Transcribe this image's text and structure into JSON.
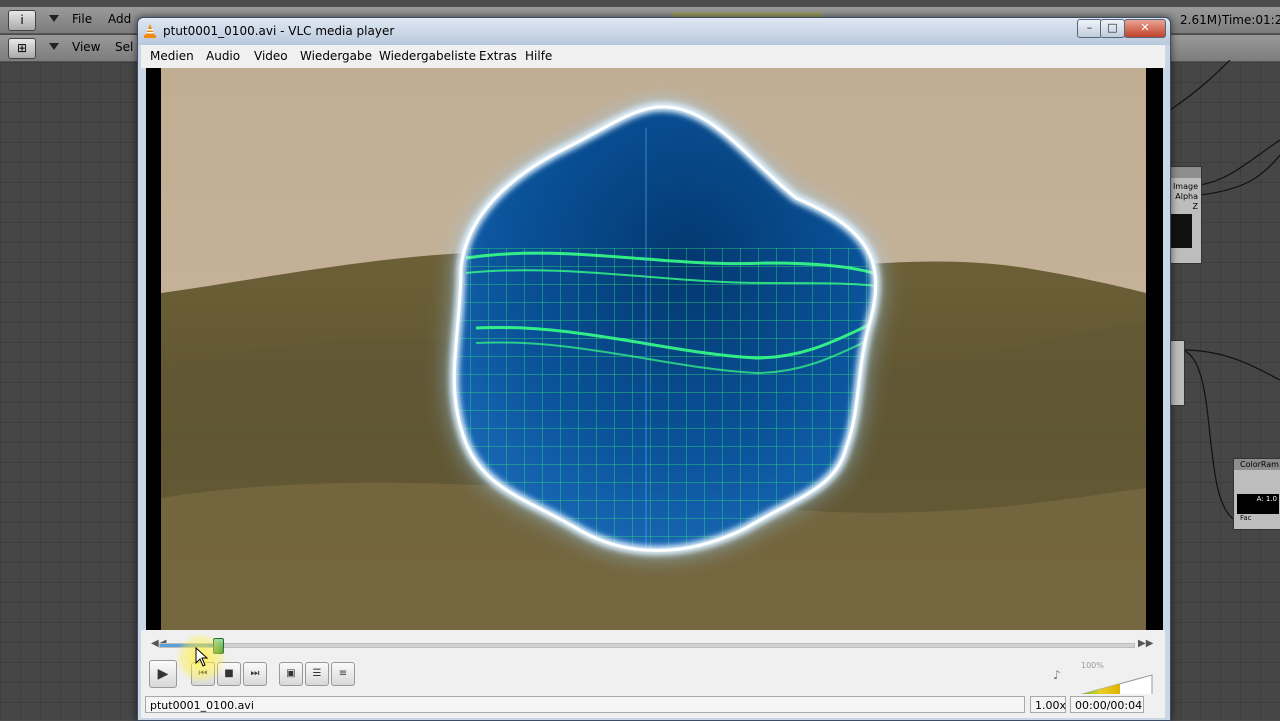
{
  "blender": {
    "top_menu": [
      "File",
      "Add"
    ],
    "second_menu": [
      "View",
      "Sel"
    ],
    "time_label": "Time:01:2",
    "mem_label": "2.61M)",
    "node_image": {
      "sockets": [
        "Image",
        "Alpha",
        "Z"
      ]
    },
    "node_colorramp": {
      "title": "ColorRam",
      "alpha_label": "A: 1.0",
      "fac_label": "Fac"
    }
  },
  "vlc": {
    "window_title": "ptut0001_0100.avi - VLC media player",
    "window_controls": {
      "minimize": "–",
      "maximize": "□",
      "close": "✕"
    },
    "menu": [
      "Medien",
      "Audio",
      "Video",
      "Wiedergabe",
      "Wiedergabeliste",
      "Extras",
      "Hilfe"
    ],
    "controls": {
      "seek_left": "◀◀",
      "seek_right": "▶▶",
      "seek_progress": 0.06,
      "play": "▶",
      "prev": "⏮",
      "stop": "■",
      "next": "⏭",
      "fullscreen": "▣",
      "playlist": "☰",
      "extended": "≡",
      "volume_icon": "♪",
      "volume_label": "100%",
      "volume_level": 1.0
    },
    "status": {
      "filename": "ptut0001_0100.avi",
      "speed": "1.00x",
      "time": "00:00/00:04"
    }
  }
}
